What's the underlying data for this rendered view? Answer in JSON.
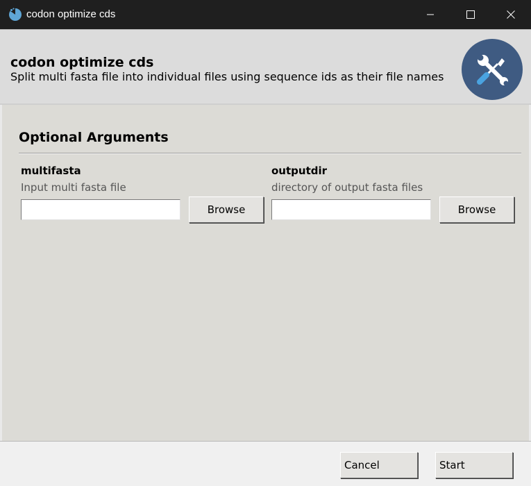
{
  "window": {
    "title": "codon optimize cds",
    "controls": {
      "minimize_icon": "minimize-icon",
      "maximize_icon": "maximize-icon",
      "close_icon": "close-icon"
    }
  },
  "header": {
    "title": "codon optimize cds",
    "description": "Split multi fasta file into individual files using sequence ids as their file names",
    "badge_icon": "tools-icon",
    "badge_color": "#3f5b82"
  },
  "section": {
    "title": "Optional Arguments"
  },
  "fields": [
    {
      "label": "multifasta",
      "help": "Input multi fasta file",
      "value": "",
      "button_label": "Browse"
    },
    {
      "label": "outputdir",
      "help": "directory of output fasta files",
      "value": "",
      "button_label": "Browse"
    }
  ],
  "footer": {
    "cancel_label": "Cancel",
    "start_label": "Start"
  }
}
